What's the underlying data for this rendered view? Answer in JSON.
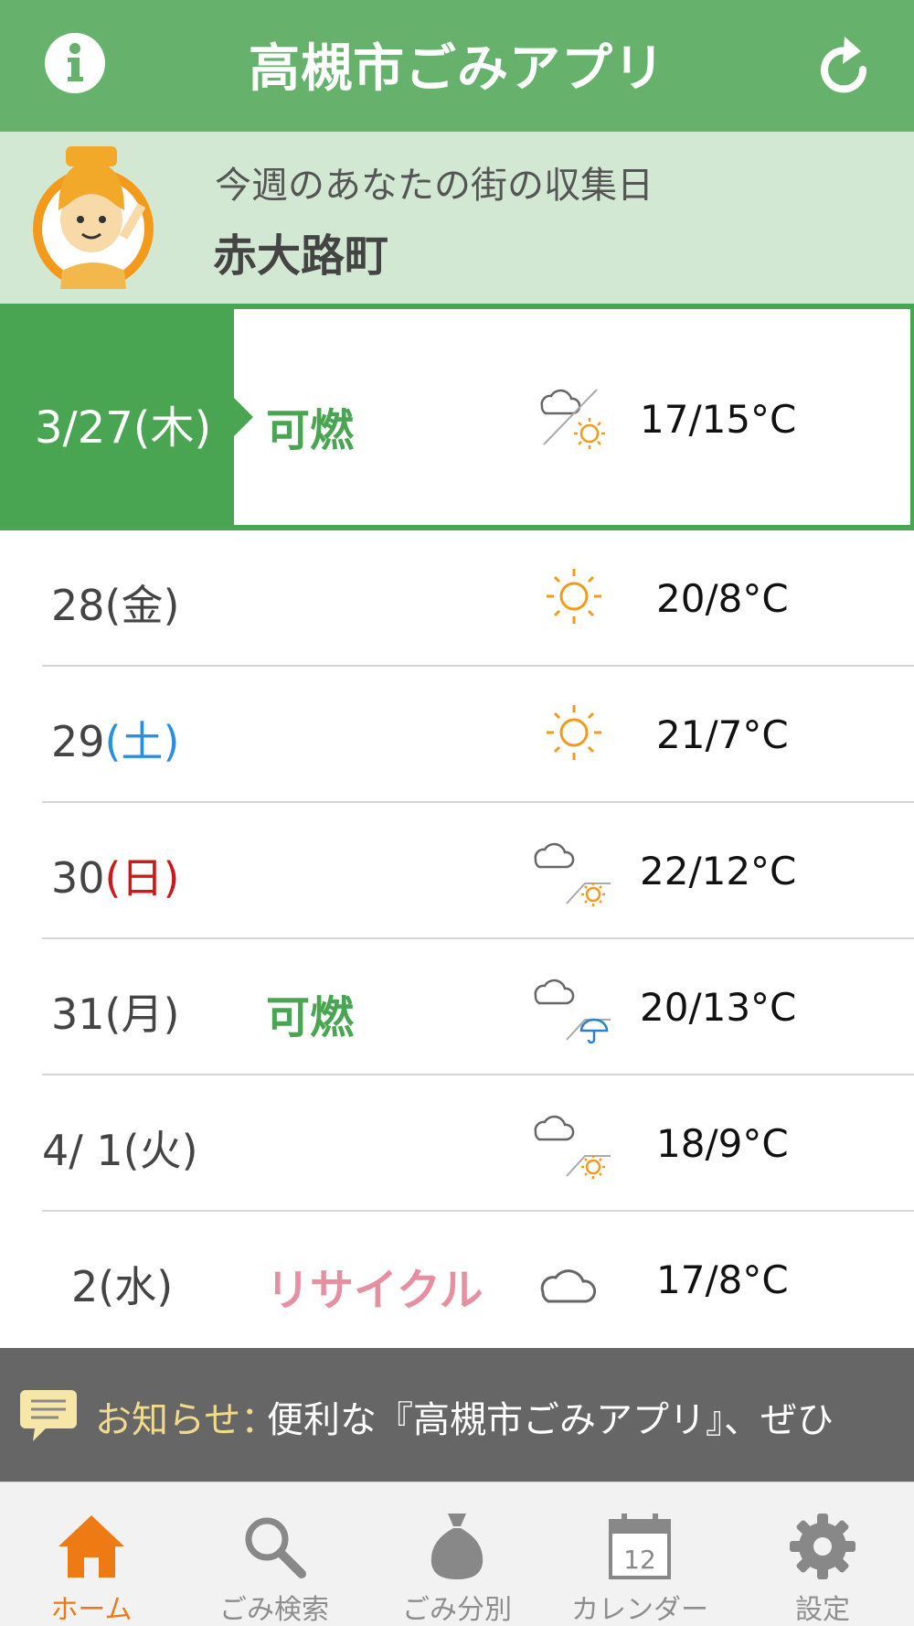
{
  "header": {
    "title": "高槻市ごみアプリ",
    "info_icon": "info-icon",
    "refresh_icon": "refresh-icon"
  },
  "area": {
    "subtitle": "今週のあなたの街の収集日",
    "town": "赤大路町"
  },
  "today": {
    "date": "3/27(木)",
    "garbage": "可燃",
    "weather": "cloudy-then-sunny",
    "temp": "17/15°C"
  },
  "days": [
    {
      "date": "28",
      "dow": "(金)",
      "garbage": "",
      "weather": "sunny",
      "temp": "20/8°C"
    },
    {
      "date": "29",
      "dow": "(土)",
      "garbage": "",
      "weather": "sunny",
      "temp": "21/7°C"
    },
    {
      "date": "30",
      "dow": "(日)",
      "garbage": "",
      "weather": "cloudy-then-sunny",
      "temp": "22/12°C"
    },
    {
      "date": "31",
      "dow": "(月)",
      "garbage": "可燃",
      "weather": "cloudy-then-rain",
      "temp": "20/13°C"
    },
    {
      "date": "4/ 1",
      "dow": "(火)",
      "garbage": "",
      "weather": "cloudy-then-sunny",
      "temp": "18/9°C"
    },
    {
      "date": "2",
      "dow": "(水)",
      "garbage": "リサイクル",
      "weather": "cloudy",
      "temp": "17/8°C"
    }
  ],
  "notice": {
    "label": "お知らせ：",
    "message": "便利な『高槻市ごみアプリ』、ぜひ"
  },
  "tabs": [
    {
      "label": "ホーム",
      "icon": "home-icon",
      "active": true
    },
    {
      "label": "ごみ検索",
      "icon": "search-icon",
      "active": false
    },
    {
      "label": "ごみ分別",
      "icon": "garbage-bag-icon",
      "active": false
    },
    {
      "label": "カレンダー",
      "icon": "calendar-icon",
      "active": false
    },
    {
      "label": "設定",
      "icon": "gear-icon",
      "active": false
    }
  ],
  "colors": {
    "header_green": "#66b26d",
    "today_green": "#4aa552",
    "burnable_green": "#4aa552",
    "recycle_pink": "#e58fa0",
    "saturday_blue": "#2a8fe0",
    "sunday_red": "#cc1a1a",
    "active_tab_orange": "#ee7a14"
  }
}
